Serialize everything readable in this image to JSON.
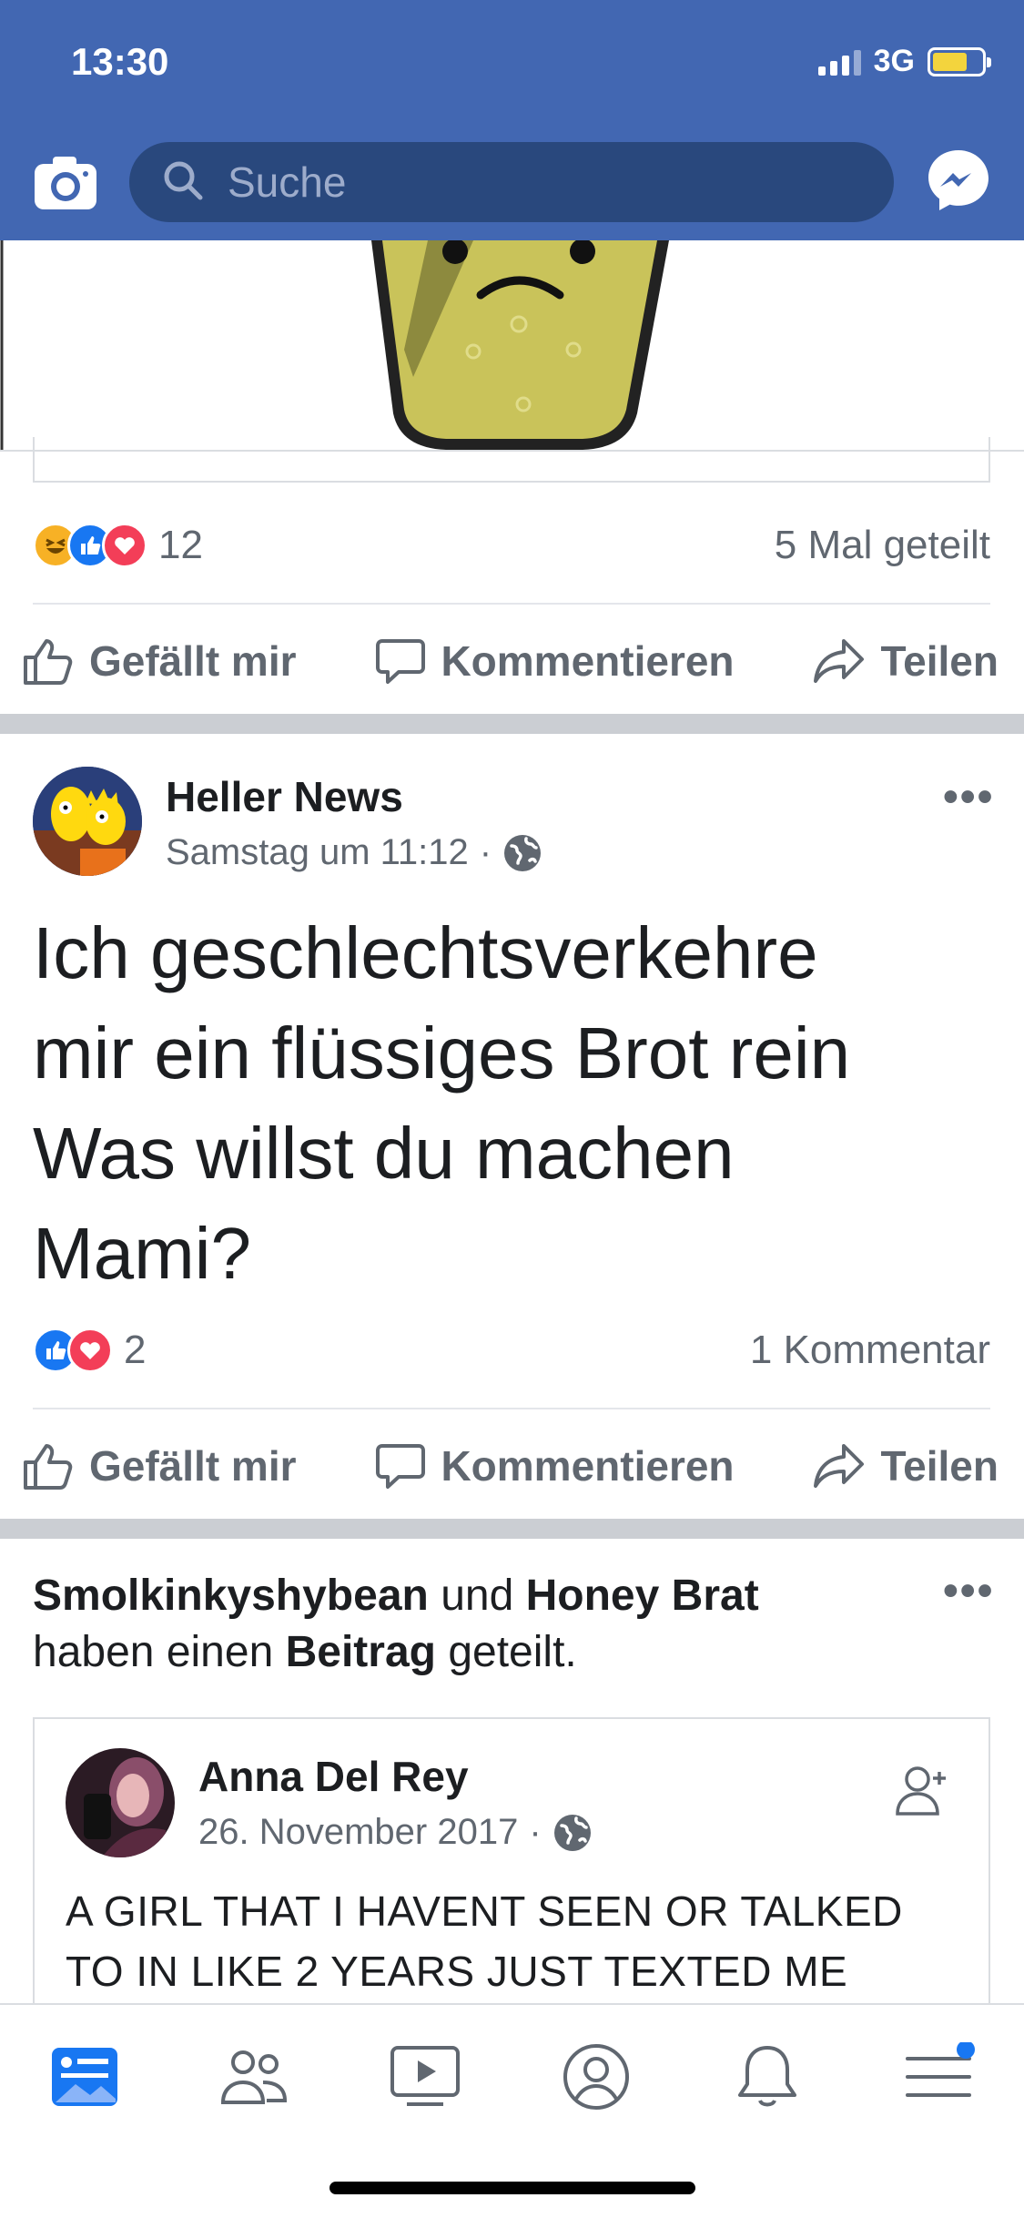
{
  "status_bar": {
    "time": "13:30",
    "network": "3G"
  },
  "search": {
    "placeholder": "Suche"
  },
  "top_post": {
    "reaction_count": "12",
    "shares": "5 Mal geteilt",
    "actions": {
      "like": "Gefällt mir",
      "comment": "Kommentieren",
      "share": "Teilen"
    }
  },
  "post": {
    "author": "Heller News",
    "time": "Samstag um 11:12",
    "dot": "·",
    "text_lines": [
      "Ich geschlechtsverkehre",
      "mir ein flüssiges Brot rein",
      "Was willst du machen",
      "Mami?"
    ],
    "reaction_count": "2",
    "comments": "1 Kommentar",
    "actions": {
      "like": "Gefällt mir",
      "comment": "Kommentieren",
      "share": "Teilen"
    }
  },
  "shared_post": {
    "user1": "Smolkinkyshybean",
    "conj": "und",
    "user2": "Honey Brat",
    "phrase1": "haben einen",
    "object": "Beitrag",
    "phrase2": "geteilt.",
    "original_author": "Anna Del Rey",
    "original_date": "26. November 2017",
    "dot": "·",
    "text_lines": [
      "A GIRL THAT I HAVENT SEEN OR TALKED",
      "TO IN LIKE 2 YEARS JUST TEXTED ME"
    ]
  },
  "more_icon": "•••",
  "icons": [
    "camera-icon",
    "search-icon",
    "messenger-icon",
    "globe-icon",
    "like-icon",
    "comment-icon",
    "share-icon",
    "add-friend-icon",
    "news-feed-icon",
    "friends-icon",
    "watch-icon",
    "profile-icon",
    "notifications-icon",
    "menu-icon"
  ],
  "colors": {
    "brand": "#4267b2",
    "search_bg": "#29487d",
    "like_blue": "#1877f2",
    "love_red": "#f33e58",
    "haha_yellow": "#f7b125"
  }
}
